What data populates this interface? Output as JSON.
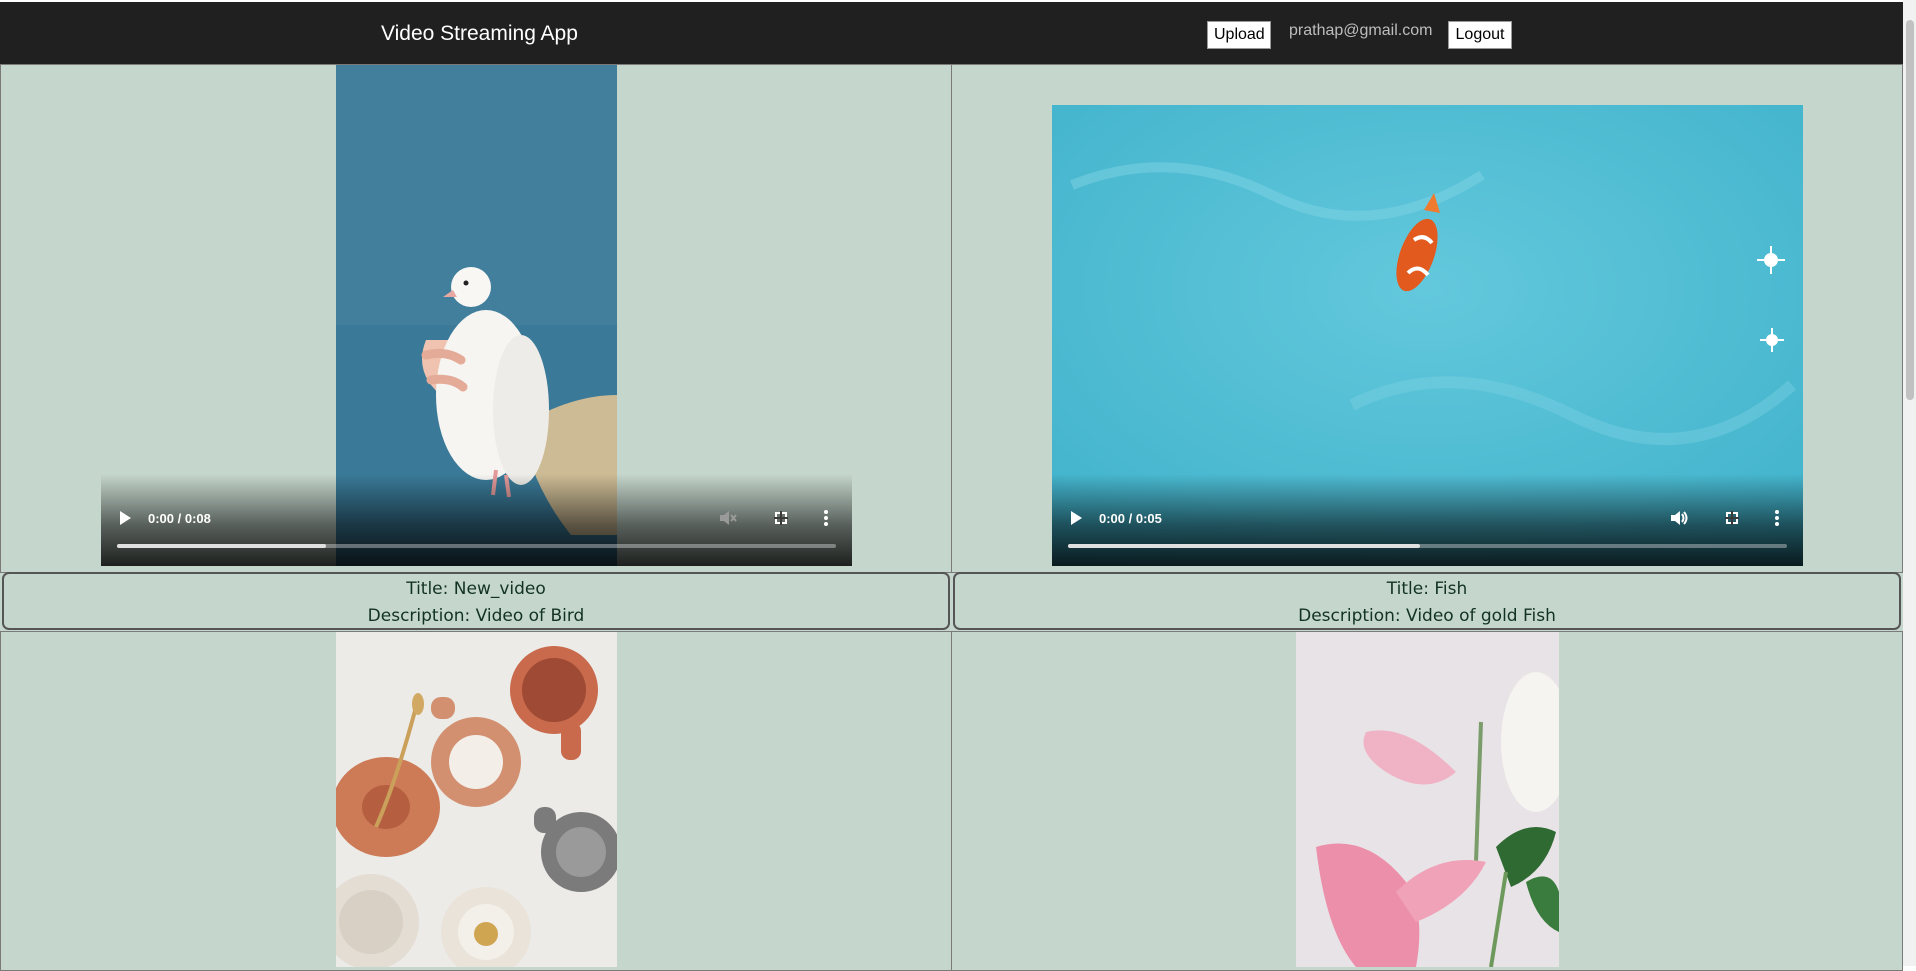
{
  "navbar": {
    "title": "Video Streaming App",
    "upload_label": "Upload",
    "user_email": "prathap@gmail.com",
    "logout_label": "Logout"
  },
  "videos": [
    {
      "time": "0:00 / 0:08",
      "title_text": "Title: New_video",
      "description_text": "Description: Video of Bird",
      "progress": 0.29,
      "muted": true
    },
    {
      "time": "0:00 / 0:05",
      "title_text": "Title: Fish",
      "description_text": "Description: Video of gold Fish",
      "progress": 0.49,
      "muted": false
    },
    {
      "subject": "cups"
    },
    {
      "subject": "flowers"
    }
  ],
  "colors": {
    "navbar_bg": "#202020",
    "page_bg": "#c5d6cc",
    "caption_text": "#123322"
  }
}
